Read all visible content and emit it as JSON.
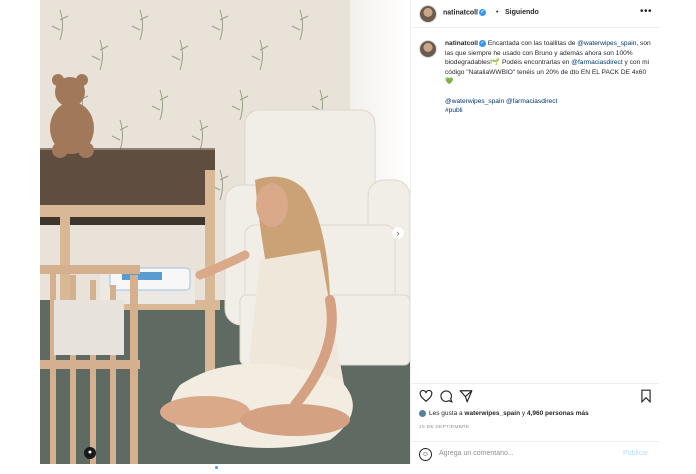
{
  "post": {
    "username": "natinatcoll",
    "follow_status": "Siguiendo",
    "more_icon": "ellipsis-icon",
    "caption": {
      "username": "natinatcoll",
      "line1_text": "Encantada con las toallitas de ",
      "mention_brand": "@waterwipes_spain",
      "line1_rest": ", son las que siempre he usado con Bruno y además ahora son 100% biodegradables!🌱 Podéis encontrarlas en ",
      "mention_pharmacy": "@farmaciasdirect",
      "line2_rest": " y con mi código \"NataliaWWBIO\" tenéis un 20% de dto EN EL PACK DE 4x60 💚",
      "tags_mention1": "@waterwipes_spain",
      "tags_mention2": "@farmaciasdirect",
      "hashtag": "#publi"
    },
    "likes": {
      "prefix": "Les gusta a ",
      "user": "waterwipes_spain",
      "middle": " y ",
      "count": "4,960 personas más"
    },
    "date": "19 DE SEPTIEMBRE",
    "comment": {
      "placeholder": "Agrega un comentario...",
      "publish_label": "Publicar"
    }
  },
  "colors": {
    "link": "#00376b",
    "verified": "#3897f0",
    "publish_disabled": "#b2dffc"
  }
}
